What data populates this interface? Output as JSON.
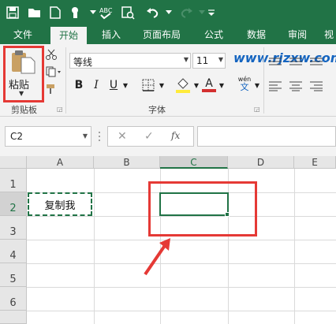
{
  "colors": {
    "brand": "#217346",
    "highlight": "#e53935",
    "watermark": "#1565c0"
  },
  "quick_access": {
    "icons": [
      "save-icon",
      "open-folder-icon",
      "new-file-icon",
      "touch-mode-icon",
      "spell-check-icon",
      "print-preview-icon",
      "undo-icon",
      "redo-icon",
      "customize-icon"
    ]
  },
  "tabs": [
    {
      "label": "文件"
    },
    {
      "label": "开始"
    },
    {
      "label": "插入"
    },
    {
      "label": "页面布局"
    },
    {
      "label": "公式"
    },
    {
      "label": "数据"
    },
    {
      "label": "审阅"
    },
    {
      "label": "视"
    }
  ],
  "ribbon": {
    "clipboard": {
      "paste_label": "粘贴",
      "group_label": "剪贴板"
    },
    "font": {
      "name": "等线",
      "size": "11",
      "group_label": "字体",
      "bold": "B",
      "italic": "I",
      "underline": "U",
      "font_color_letter": "A",
      "phonetic_label": "wén",
      "phonetic_char": "文"
    },
    "watermark": "www.rjzxw.com"
  },
  "formula_bar": {
    "name_box": "C2",
    "fx_label": "fx",
    "formula": ""
  },
  "grid": {
    "columns": [
      "A",
      "B",
      "C",
      "D",
      "E"
    ],
    "rows": [
      "1",
      "2",
      "3",
      "4",
      "5",
      "6"
    ],
    "selected_column": "C",
    "selected_row": "2",
    "cells": {
      "A2": "复制我"
    }
  }
}
